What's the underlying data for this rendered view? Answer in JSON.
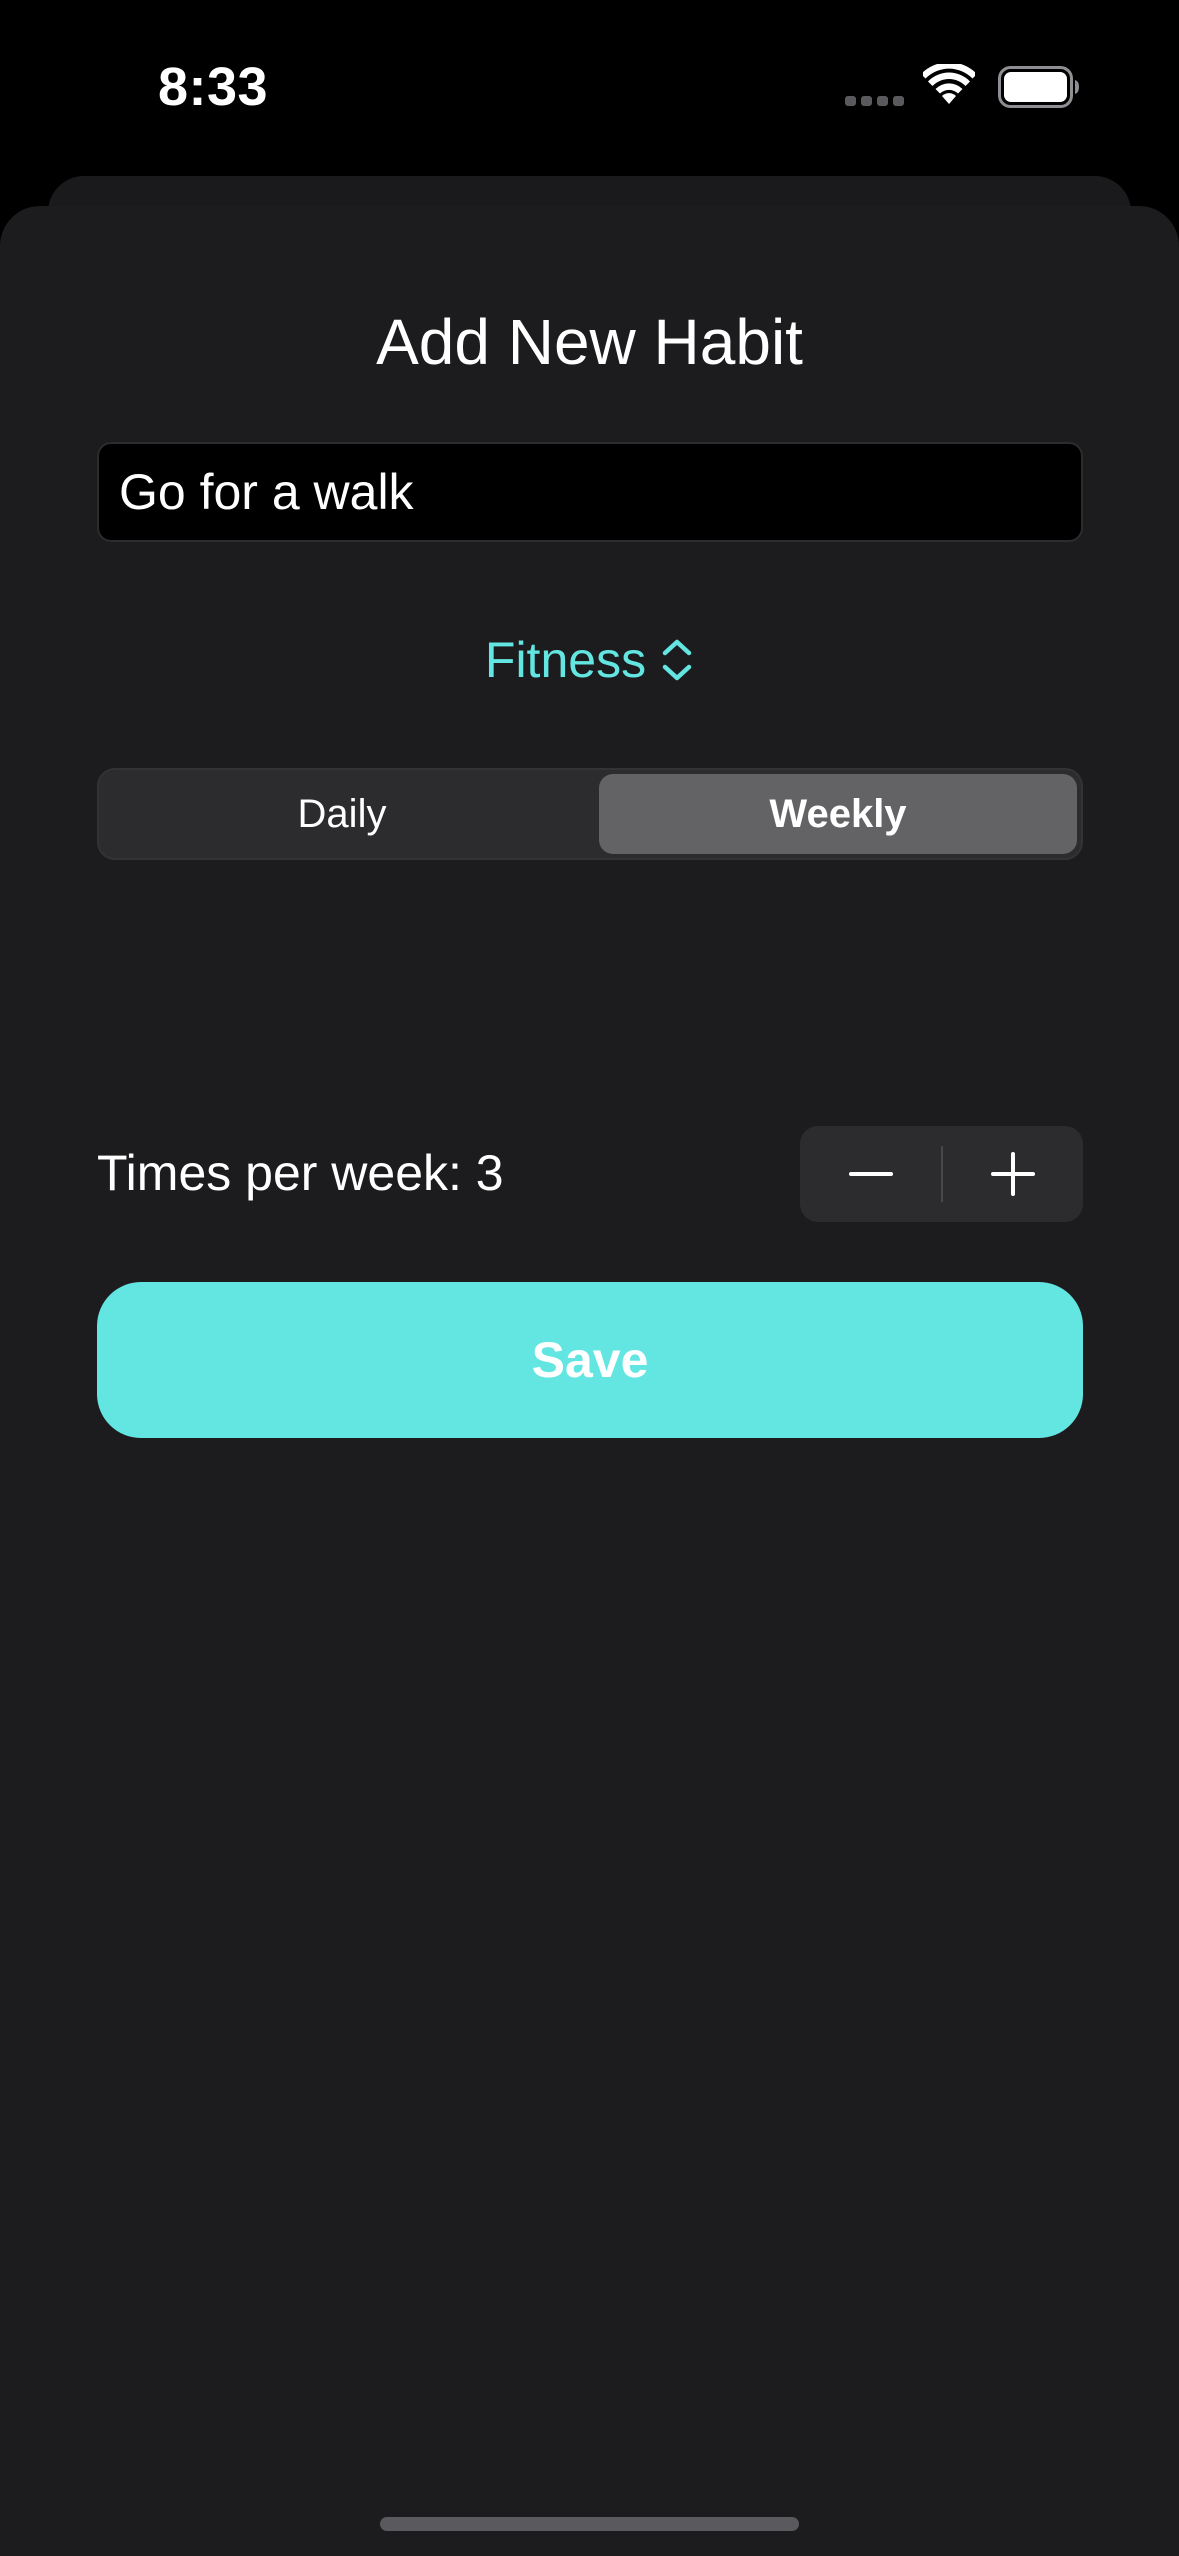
{
  "status_bar": {
    "time": "8:33"
  },
  "sheet": {
    "title": "Add New Habit",
    "name_input": {
      "value": "Go for a walk"
    },
    "category": {
      "selected": "Fitness"
    },
    "frequency": {
      "options": [
        "Daily",
        "Weekly"
      ],
      "selected": "Weekly"
    },
    "times_per_week": {
      "label": "Times per week: 3",
      "value": 3
    },
    "save_label": "Save"
  },
  "colors": {
    "accent": "#63e6e2",
    "sheet_background": "#1c1c1e",
    "segment_selected": "#636366"
  },
  "icons": {
    "category_picker": "chevron-up-down-icon",
    "stepper_minus": "minus-icon",
    "stepper_plus": "plus-icon",
    "status_wifi": "wifi-icon",
    "status_battery": "battery-icon"
  }
}
